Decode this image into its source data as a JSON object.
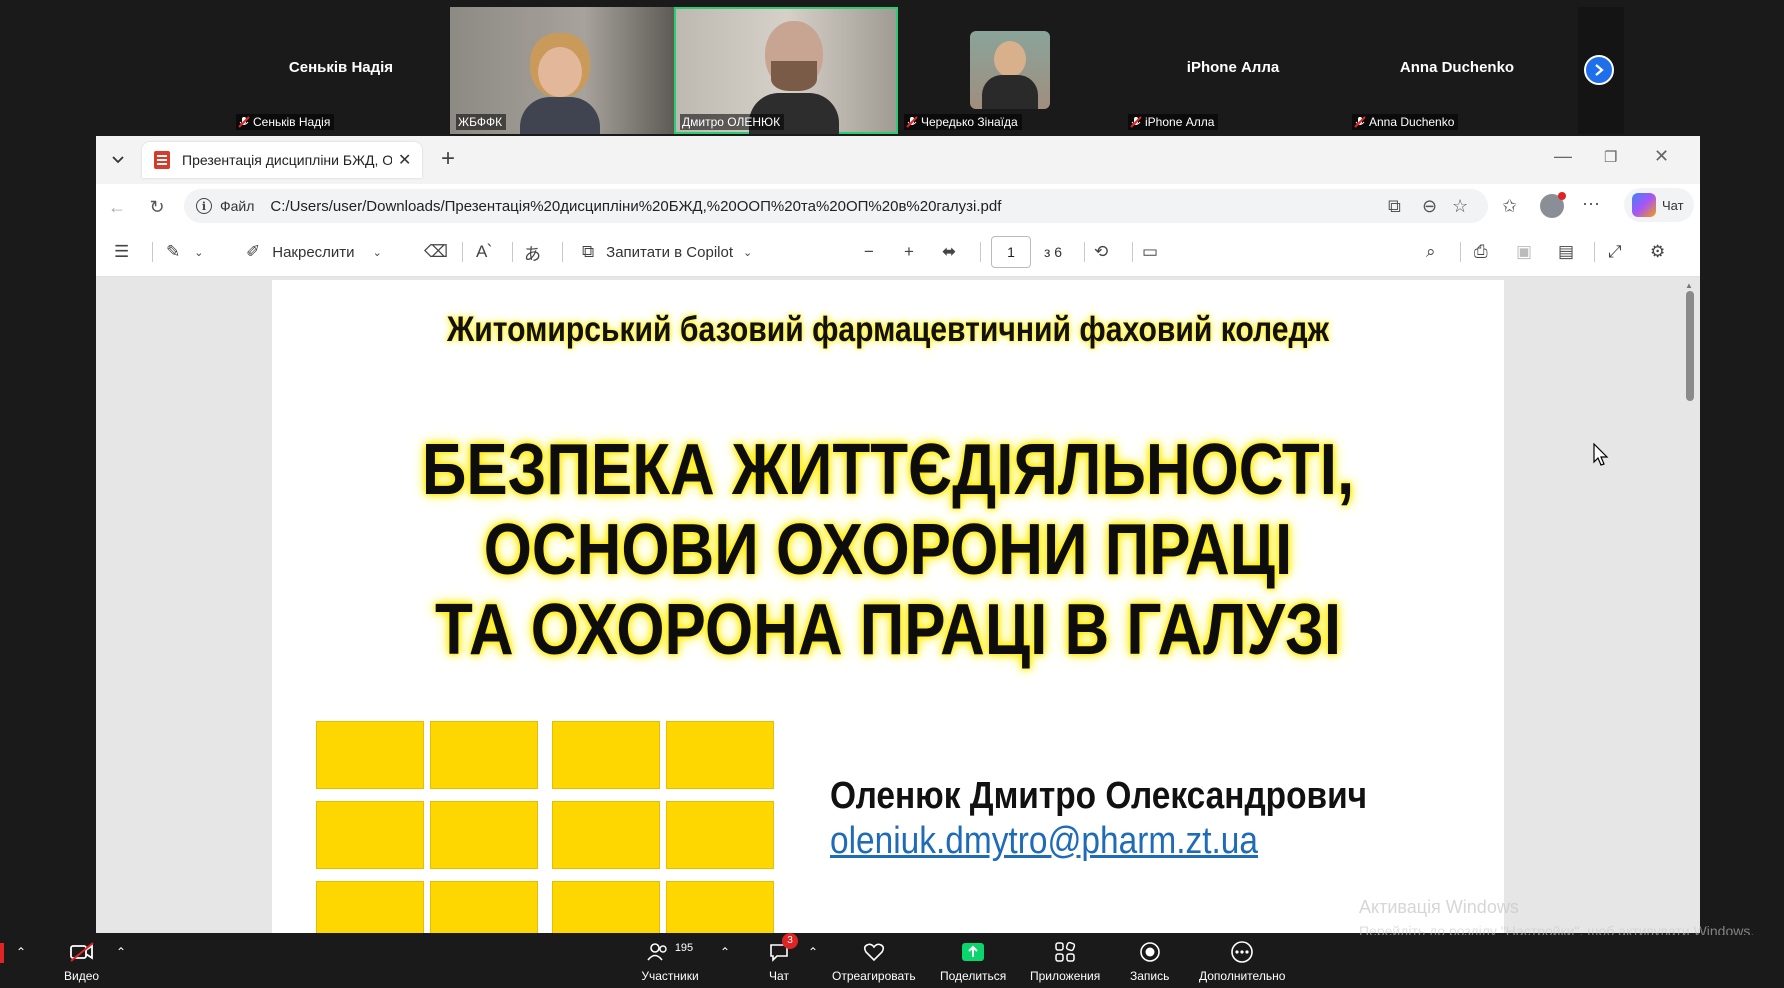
{
  "participants": [
    {
      "big_name": "Сеньків Надія",
      "label": "Сеньків Надія",
      "muted": true
    },
    {
      "label": "ЖБФФК",
      "video": true
    },
    {
      "label": "Дмитро ОЛЕНЮК",
      "video": true,
      "active": true
    },
    {
      "label": "Чередько Зінаїда",
      "muted": true,
      "photo": true
    },
    {
      "big_name": "iPhone Алла",
      "label": "iPhone Алла",
      "muted": true
    },
    {
      "big_name": "Anna Duchenko",
      "label": "Anna Duchenko",
      "muted": true
    }
  ],
  "browser": {
    "tab_title": "Презентація дисципліни БЖД, О",
    "address_scheme": "Файл",
    "url": "C:/Users/user/Downloads/Презентація%20дисципліни%20БЖД,%20ООП%20та%20ОП%20в%20галузі.pdf",
    "chat_label": "Чат"
  },
  "pdf_toolbar": {
    "draw_label": "Накреслити",
    "copilot_label": "Запитати в Copilot",
    "page_number": "1",
    "page_total": "з 6"
  },
  "slide": {
    "college": "Житомирський базовий фармацевтичний фаховий коледж",
    "title_line1": "БЕЗПЕКА ЖИТТЄДІЯЛЬНОСТІ,",
    "title_line2": "ОСНОВИ ОХОРОНИ ПРАЦІ",
    "title_line3": "ТА ОХОРОНА ПРАЦІ В ГАЛУЗІ",
    "author": "Оленюк Дмитро Олександрович",
    "email": "oleniuk.dmytro@pharm.zt.ua"
  },
  "watermark": {
    "line1": "Активація Windows",
    "line2": "Перейдіть до розділу \"Настройки\", щоб активувати Windows."
  },
  "bottom_bar": {
    "video_label": "Видео",
    "participants_label": "Участники",
    "participants_count": "195",
    "chat_label": "Чат",
    "chat_badge": "3",
    "react_label": "Отреагировать",
    "share_label": "Поделиться",
    "apps_label": "Приложения",
    "record_label": "Запись",
    "more_label": "Дополнительно"
  },
  "colors": {
    "share_green": "#0bd66d",
    "active_border": "#2ecc71",
    "link_blue": "#1e6bb8",
    "highlight_yellow": "#ffe600"
  }
}
